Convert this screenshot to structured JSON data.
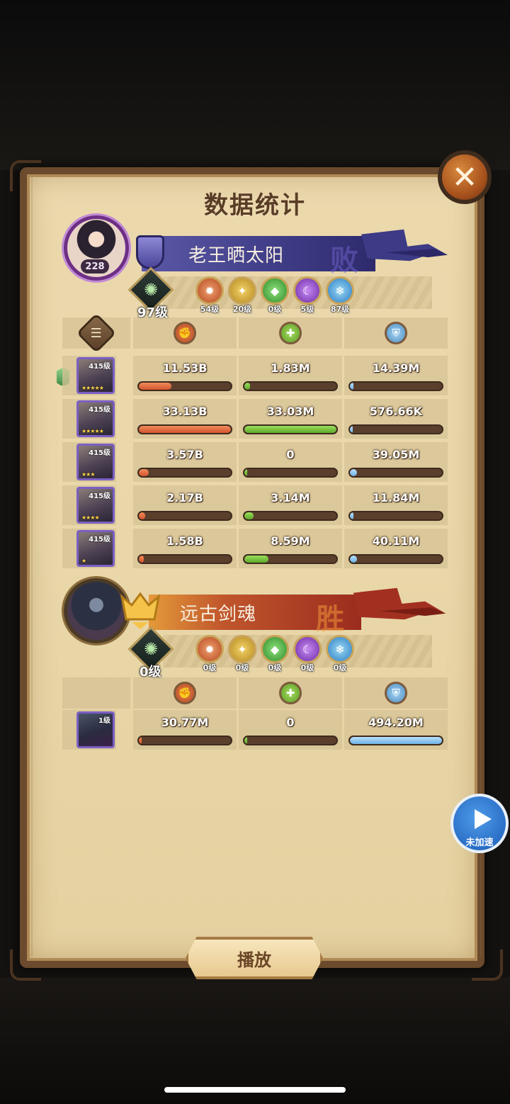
{
  "title": "数据统计",
  "close_icon_label": "✕",
  "play_button": "播放",
  "speed_button": "未加速",
  "colors": {
    "damage": "#d4552d",
    "heal": "#5ea82a",
    "tank": "#6eb3e6",
    "loser_banner": "#3f3c86",
    "winner_banner": "#c0562c"
  },
  "teams": [
    {
      "player_name": "老王晒太阳",
      "result": "败",
      "avatar_level": "228",
      "tree_level": "97级",
      "factions": [
        {
          "icon": "fire-faction-icon",
          "level": "54级"
        },
        {
          "icon": "light-faction-icon",
          "level": "20级"
        },
        {
          "icon": "nature-faction-icon",
          "level": "0级"
        },
        {
          "icon": "arcane-faction-icon",
          "level": "5级"
        },
        {
          "icon": "frost-faction-icon",
          "level": "87级"
        }
      ],
      "heroes": [
        {
          "level": "415级",
          "stars": "★★★★★",
          "damage": "11.53B",
          "damage_frac": 0.35,
          "heal": "1.83M",
          "heal_frac": 0.06,
          "tank": "14.39M",
          "tank_frac": 0.03
        },
        {
          "level": "415级",
          "stars": "★★★★★",
          "damage": "33.13B",
          "damage_frac": 1.0,
          "heal": "33.03M",
          "heal_frac": 1.0,
          "tank": "576.66K",
          "tank_frac": 0.0
        },
        {
          "level": "415级",
          "stars": "★★★",
          "damage": "3.57B",
          "damage_frac": 0.11,
          "heal": "0",
          "heal_frac": 0.0,
          "tank": "39.05M",
          "tank_frac": 0.08
        },
        {
          "level": "415级",
          "stars": "★★★★",
          "damage": "2.17B",
          "damage_frac": 0.07,
          "heal": "3.14M",
          "heal_frac": 0.1,
          "tank": "11.84M",
          "tank_frac": 0.02
        },
        {
          "level": "415级",
          "stars": "★",
          "damage": "1.58B",
          "damage_frac": 0.05,
          "heal": "8.59M",
          "heal_frac": 0.26,
          "tank": "40.11M",
          "tank_frac": 0.08
        }
      ]
    },
    {
      "player_name": "远古剑魂",
      "result": "胜",
      "tree_level": "0级",
      "factions": [
        {
          "icon": "fire-faction-icon",
          "level": "0级"
        },
        {
          "icon": "light-faction-icon",
          "level": "0级"
        },
        {
          "icon": "nature-faction-icon",
          "level": "0级"
        },
        {
          "icon": "arcane-faction-icon",
          "level": "0级"
        },
        {
          "icon": "frost-faction-icon",
          "level": "0级"
        }
      ],
      "heroes": [
        {
          "level": "1级",
          "stars": "",
          "damage": "30.77M",
          "damage_frac": 0.0,
          "heal": "0",
          "heal_frac": 0.0,
          "tank": "494.20M",
          "tank_frac": 1.0
        }
      ]
    }
  ]
}
